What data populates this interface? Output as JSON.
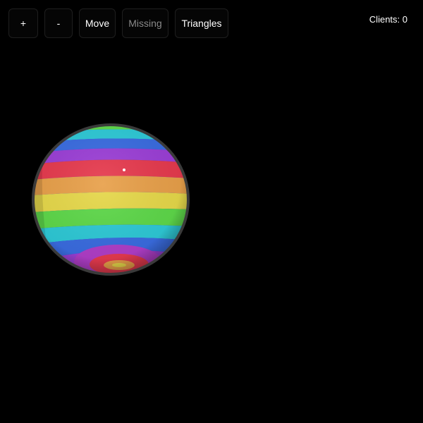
{
  "toolbar": {
    "buttons": [
      {
        "label": "+",
        "enabled": true
      },
      {
        "label": "-",
        "enabled": true
      },
      {
        "label": "Move",
        "enabled": true
      },
      {
        "label": "Missing",
        "enabled": false
      },
      {
        "label": "Triangles",
        "enabled": true
      }
    ]
  },
  "status": {
    "clients_text": "Clients: 0"
  },
  "colors": {
    "background": "#000000",
    "button_text": "#ffffff",
    "disabled_text": "#8a8a8a",
    "globe_outline": "#3a3a3a",
    "stripes": [
      "#9b3fd6",
      "#e63a4e",
      "#e8a04a",
      "#e6d84a",
      "#5ed84a",
      "#2ec9d6",
      "#3a6ce0"
    ]
  }
}
